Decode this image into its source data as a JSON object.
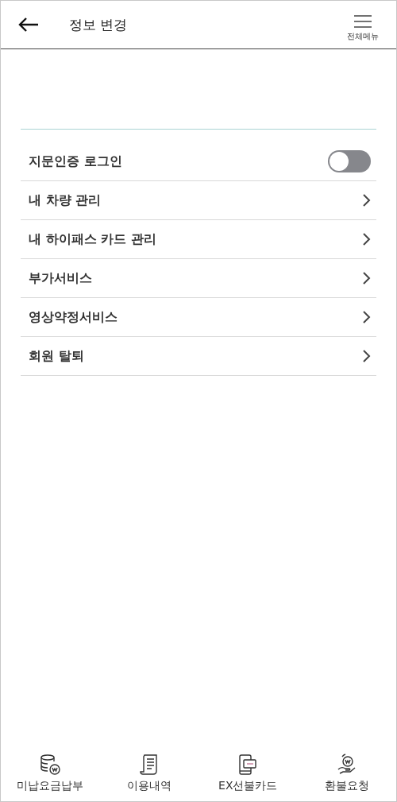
{
  "header": {
    "title": "정보 변경",
    "menu_label": "전체메뉴"
  },
  "settings": [
    {
      "kind": "toggle",
      "label": "지문인증 로그인",
      "on": false
    },
    {
      "kind": "link",
      "label": "내 차량 관리"
    },
    {
      "kind": "link",
      "label": "내 하이패스 카드 관리"
    },
    {
      "kind": "link",
      "label": "부가서비스"
    },
    {
      "kind": "link",
      "label": "영상약정서비스"
    },
    {
      "kind": "link",
      "label": "회원 탈퇴"
    }
  ],
  "bottom_nav": [
    {
      "kind": "coins",
      "label": "미납요금납부"
    },
    {
      "kind": "receipt",
      "label": "이용내역"
    },
    {
      "kind": "card",
      "label": "EX선불카드"
    },
    {
      "kind": "refund",
      "label": "환불요청"
    }
  ]
}
